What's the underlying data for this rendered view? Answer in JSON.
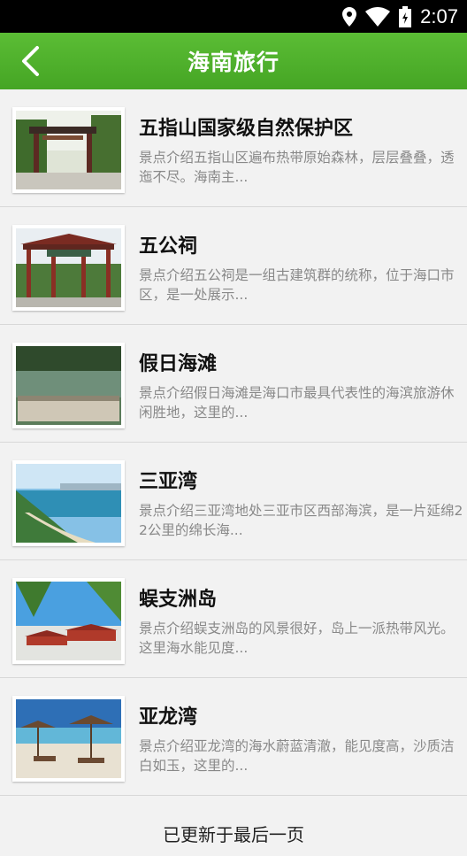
{
  "status_bar": {
    "time": "2:07"
  },
  "app_bar": {
    "title": "海南旅行"
  },
  "items": [
    {
      "title": "五指山国家级自然保护区",
      "desc": "景点介绍五指山区遍布热带原始森林，层层叠叠，透迤不尽。海南主..."
    },
    {
      "title": "五公祠",
      "desc": "景点介绍五公祠是一组古建筑群的统称，位于海口市区，是一处展示..."
    },
    {
      "title": "假日海滩",
      "desc": "景点介绍假日海滩是海口市最具代表性的海滨旅游休闲胜地，这里的..."
    },
    {
      "title": "三亚湾",
      "desc": "景点介绍三亚湾地处三亚市区西部海滨，是一片延绵22公里的绵长海..."
    },
    {
      "title": "蜈支洲岛",
      "desc": "景点介绍蜈支洲岛的风景很好，岛上一派热带风光。这里海水能见度..."
    },
    {
      "title": "亚龙湾",
      "desc": "景点介绍亚龙湾的海水蔚蓝清澈，能见度高，沙质洁白如玉，这里的..."
    }
  ],
  "footer": {
    "text": "已更新于最后一页"
  }
}
